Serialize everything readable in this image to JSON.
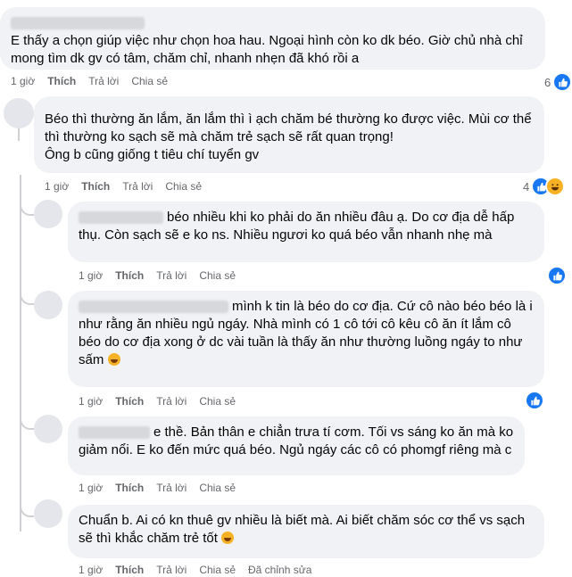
{
  "comments": [
    {
      "text_lines": [
        "E thấy a chọn giúp việc như chọn hoa hau. Ngoại hình còn ko dk béo. Giờ chủ nhà chỉ",
        "mong tìm dk gv có tâm, chăm chỉ, nhanh nhẹn đã khó rồi a"
      ],
      "time": "1 giờ",
      "like": "Thích",
      "reply": "Trả lời",
      "share": "Chia sẻ",
      "reaction_count": "6"
    },
    {
      "text_lines": [
        "Béo thì thường ăn lắm, ăn lắm thì ì ạch chăm bé thường ko được việc. Mùi cơ thể",
        "thì thường ko sạch sẽ mà chăm trẻ sạch sẽ rất quan trọng!",
        "Ông b cũng giống t tiêu chí tuyển gv"
      ],
      "time": "1 giờ",
      "like": "Thích",
      "reply": "Trả lời",
      "share": "Chia sẻ",
      "reaction_count": "4"
    },
    {
      "text_lines": [
        "béo nhiều khi ko phải do ăn nhiều đâu ạ. Do cơ địa dễ hấp",
        "thụ. Còn sạch sẽ e ko ns. Nhiều ngươi ko quá béo vẫn nhanh nhẹ mà"
      ],
      "time": "1 giờ",
      "like": "Thích",
      "reply": "Trả lời",
      "share": "Chia sẻ"
    },
    {
      "text_lines": [
        "mình k tin là béo do cơ địa. Cứ cô nào béo béo là i",
        "như rằng ăn nhiều ngủ ngáy. Nhà mình có 1 cô tới cô kêu cô ăn ít lắm cô",
        "béo do cơ địa xong ở dc vài tuần là thấy ăn như thường luồng ngáy to như",
        "sấm"
      ],
      "time": "1 giờ",
      "like": "Thích",
      "reply": "Trả lời",
      "share": "Chia sẻ"
    },
    {
      "text_lines": [
        "e thề. Bản thân e chiẳn trưa tí cơm. Tối vs sáng ko ăn mà ko",
        "giảm nổi. E ko đến mức quá béo. Ngủ ngáy các cô có phomgf riêng mà c"
      ],
      "time": "1 giờ",
      "like": "Thích",
      "reply": "Trả lời",
      "share": "Chia sẻ"
    },
    {
      "text_lines": [
        "Chuẩn b. Ai có kn thuê gv nhiều là biết mà. Ai biết chăm sóc cơ thể vs sạch",
        "sẽ thì khắc chăm trẻ tốt"
      ],
      "time": "1 giờ",
      "like": "Thích",
      "reply": "Trả lời",
      "share": "Chia sẻ",
      "edited": "Đã chỉnh sửa"
    }
  ],
  "icons": {
    "like": "thumbs-up-icon",
    "haha": "laughing-emoji-icon",
    "smile": "grinning-emoji-icon"
  },
  "colors": {
    "bubble": "#f0f2f5",
    "like_blue": "#1877f2",
    "haha_yellow": "#f7b125",
    "meta_gray": "#65676b"
  }
}
